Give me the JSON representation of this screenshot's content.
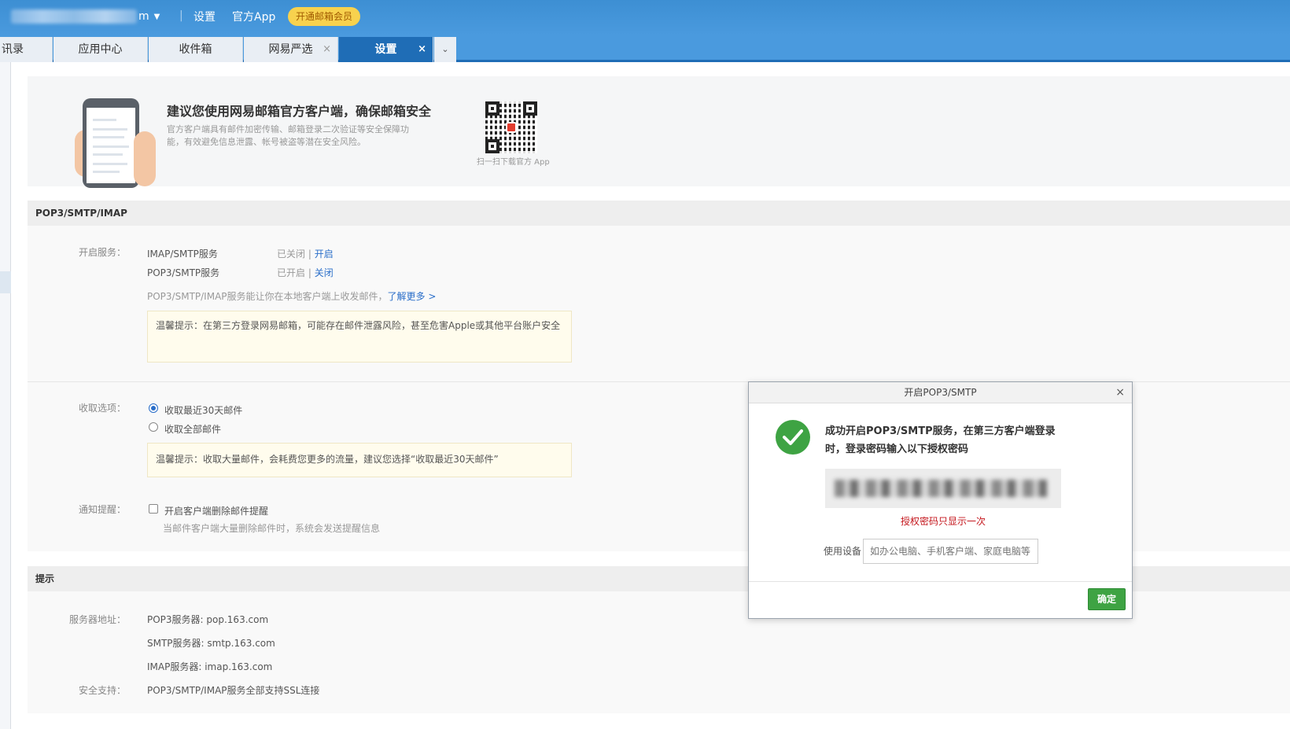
{
  "header": {
    "account_suffix": "m",
    "settings_link": "设置",
    "app_link": "官方App",
    "vip_button": "开通邮箱会员"
  },
  "tabs": [
    {
      "label": "讯录"
    },
    {
      "label": "应用中心"
    },
    {
      "label": "收件箱"
    },
    {
      "label": "网易严选",
      "close": "×"
    },
    {
      "label": "设置",
      "close": "×"
    }
  ],
  "promo": {
    "title": "建议您使用网易邮箱官方客户端，确保邮箱安全",
    "desc": "官方客户端具有邮件加密传输、邮箱登录二次验证等安全保障功能，有效避免信息泄露、帐号被盗等潜在安全风险。",
    "qr_caption": "扫一扫下载官方 App"
  },
  "pop_section": {
    "title": "POP3/SMTP/IMAP",
    "service_label": "开启服务：",
    "services": [
      {
        "name": "IMAP/SMTP服务",
        "status": "已关闭",
        "sep": " | ",
        "action": "开启"
      },
      {
        "name": "POP3/SMTP服务",
        "status": "已开启",
        "sep": " | ",
        "action": "关闭"
      }
    ],
    "info": "POP3/SMTP/IMAP服务能让你在本地客户端上收发邮件，",
    "learn_more": "了解更多 >",
    "notice1": "温馨提示：在第三方登录网易邮箱，可能存在邮件泄露风险，甚至危害Apple或其他平台账户安全",
    "fetch_label": "收取选项：",
    "fetch_options": [
      "收取最近30天邮件",
      "收取全部邮件"
    ],
    "notice2": "温馨提示：收取大量邮件，会耗费您更多的流量，建议您选择“收取最近30天邮件”",
    "notify_label": "通知提醒：",
    "notify_option": "开启客户端删除邮件提醒",
    "notify_desc": "当邮件客户端大量删除邮件时，系统会发送提醒信息"
  },
  "tips_section": {
    "title": "提示",
    "server_label": "服务器地址：",
    "servers": [
      "POP3服务器: pop.163.com",
      "SMTP服务器: smtp.163.com",
      "IMAP服务器: imap.163.com"
    ],
    "ssl_label": "安全支持：",
    "ssl_value": "POP3/SMTP/IMAP服务全部支持SSL连接"
  },
  "dialog": {
    "title": "开启POP3/SMTP",
    "close": "×",
    "message": "成功开启POP3/SMTP服务，在第三方客户端登录时，登录密码输入以下授权密码",
    "pwd_note": "授权密码只显示一次",
    "device_label": "使用设备",
    "device_placeholder": "如办公电脑、手机客户端、家庭电脑等",
    "ok_button": "确定"
  }
}
